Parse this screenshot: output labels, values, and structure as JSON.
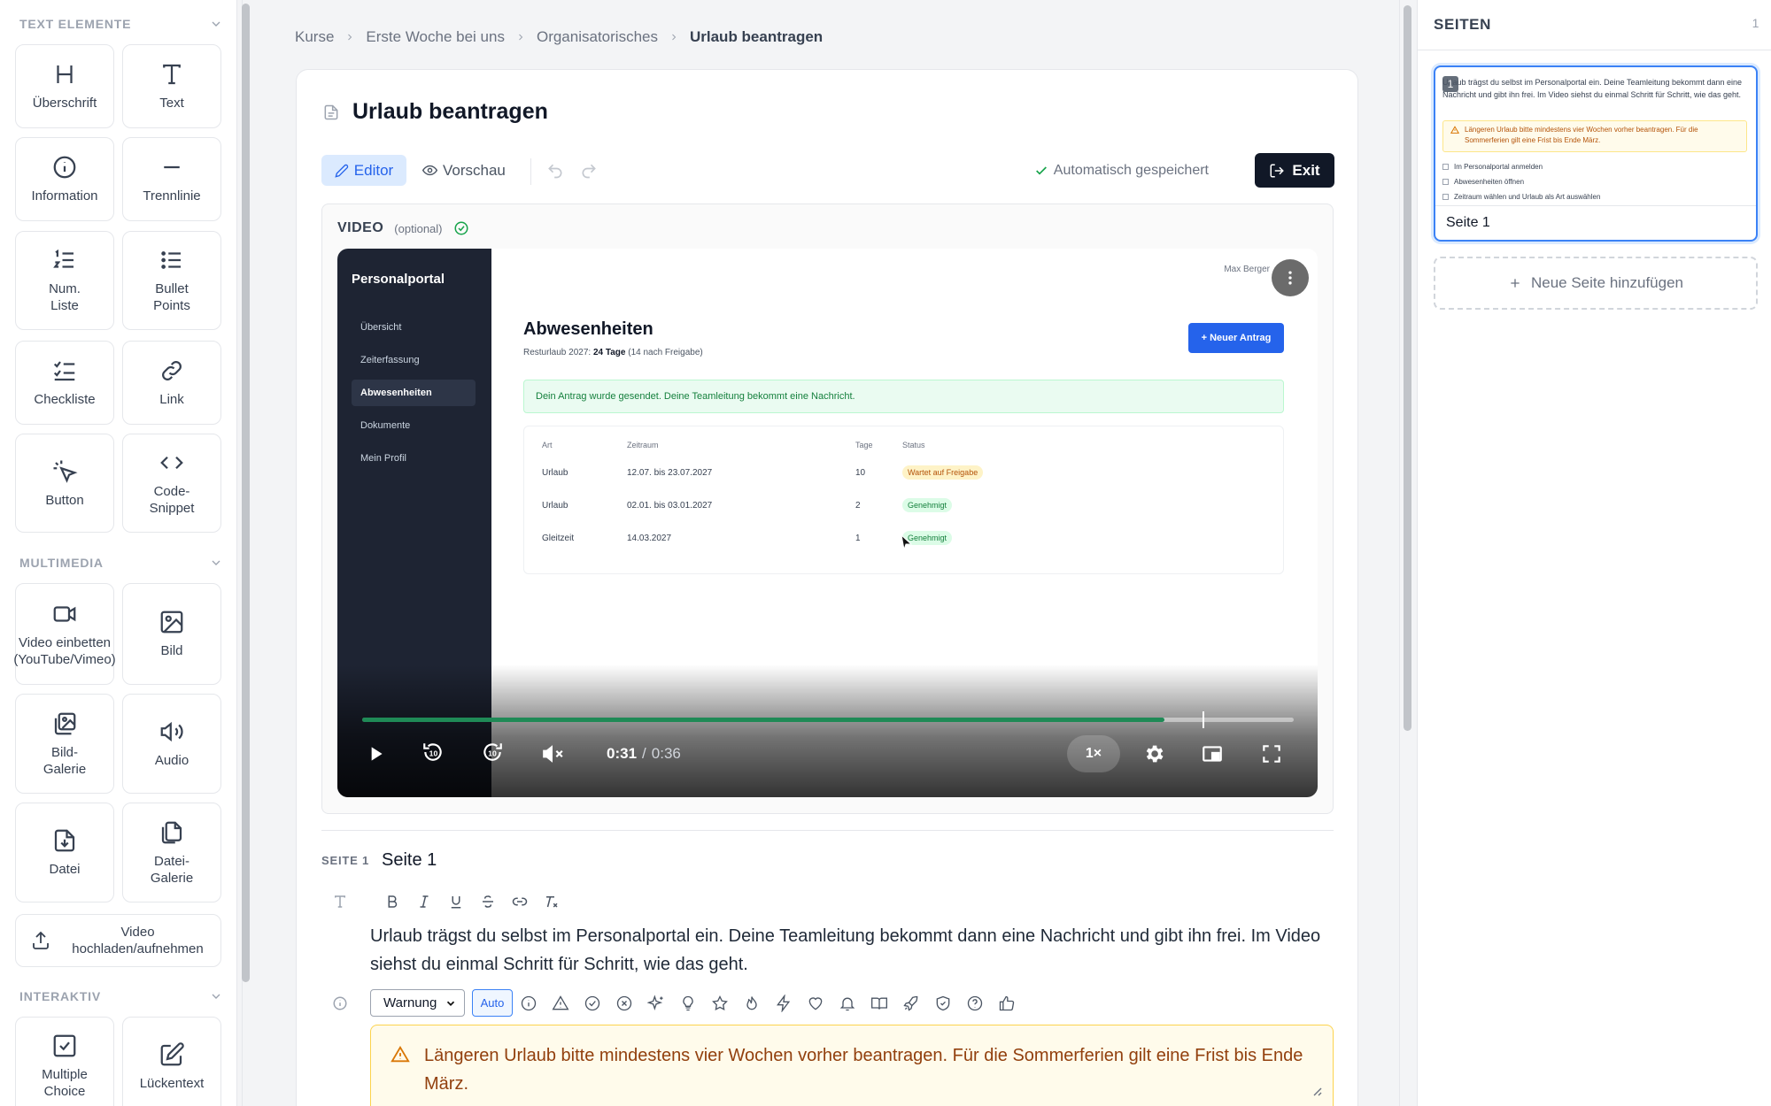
{
  "sidebar": {
    "text_section": "TEXT ELEMENTE",
    "text_items": [
      "Überschrift",
      "Text",
      "Information",
      "Trennlinie",
      "Num.\nListe",
      "Bullet\nPoints",
      "Checkliste",
      "Link",
      "Button",
      "Code-\nSnippet"
    ],
    "media_section": "MULTIMEDIA",
    "media_items": [
      "Video einbetten\n(YouTube/Vimeo)",
      "Bild",
      "Bild-\nGalerie",
      "Audio",
      "Datei",
      "Datei-\nGalerie"
    ],
    "upload_item": "Video\nhochladen/aufnehmen",
    "interactive_section": "INTERAKTIV",
    "interactive_items": [
      "Multiple\nChoice",
      "Lückentext"
    ]
  },
  "breadcrumb": [
    "Kurse",
    "Erste Woche bei uns",
    "Organisatorisches",
    "Urlaub beantragen"
  ],
  "page_title": "Urlaub beantragen",
  "toolbar": {
    "editor": "Editor",
    "preview": "Vorschau",
    "saved": "Automatisch gespeichert",
    "exit": "Exit"
  },
  "video": {
    "label": "VIDEO",
    "optional": "(optional)",
    "time_current": "0:31",
    "time_separator": "/",
    "time_total": "0:36",
    "progress": 0.861,
    "buffered": 0.902,
    "speed": "1×",
    "content": {
      "brand": "Personalportal",
      "nav": [
        "Übersicht",
        "Zeiterfassung",
        "Abwesenheiten",
        "Dokumente",
        "Mein Profil"
      ],
      "user": "Max Berger",
      "heading": "Abwesenheiten",
      "sub_prefix": "Resturlaub 2027:",
      "sub_bold": "24 Tage",
      "sub_suffix": "(14 nach Freigabe)",
      "new_button": "+ Neuer Antrag",
      "success": "Dein Antrag wurde gesendet. Deine Teamleitung bekommt eine Nachricht.",
      "table_headers": [
        "Art",
        "Zeitraum",
        "Tage",
        "Status"
      ],
      "rows": [
        {
          "art": "Urlaub",
          "zeitraum": "12.07. bis 23.07.2027",
          "tage": "10",
          "status": "Wartet auf Freigabe"
        },
        {
          "art": "Urlaub",
          "zeitraum": "02.01. bis 03.01.2027",
          "tage": "2",
          "status": "Genehmigt"
        },
        {
          "art": "Gleitzeit",
          "zeitraum": "14.03.2027",
          "tage": "1",
          "status": "Genehmigt"
        }
      ]
    }
  },
  "page_block": {
    "tag": "SEITE 1",
    "name": "Seite 1",
    "text": "Urlaub trägst du selbst im Personalportal ein. Deine Teamleitung bekommt dann eine Nachricht und gibt ihn frei. Im Video siehst du einmal Schritt für Schritt, wie das geht.",
    "callout_type": "Warnung",
    "auto": "Auto",
    "callout_text": "Längeren Urlaub bitte mindestens vier Wochen vorher beantragen. Für die Sommerferien gilt eine Frist bis Ende März."
  },
  "pages_panel": {
    "title": "SEITEN",
    "count": "1",
    "thumb_number": "1",
    "thumb_text": "Urlaub trägst du selbst im Personalportal ein. Deine Teamleitung bekommt dann eine Nachricht und gibt ihn frei. Im Video siehst du einmal Schritt für Schritt, wie das geht.",
    "thumb_warning": "Längeren Urlaub bitte mindestens vier Wochen vorher beantragen. Für die Sommerferien gilt eine Frist bis Ende März.",
    "thumb_checks": [
      "Im Personalportal anmelden",
      "Abwesenheiten öffnen",
      "Zeitraum wählen und Urlaub als Art auswählen"
    ],
    "page_name": "Seite 1",
    "add_page": "Neue Seite hinzufügen"
  },
  "colors": {
    "accent": "#2563eb",
    "progress": "#1f8a56",
    "warning_bg": "#fffbeb",
    "warning_text": "#92400e",
    "dark_button": "#111827"
  },
  "icons": {
    "text_items": [
      "heading-icon",
      "text-icon",
      "info-icon",
      "divider-icon",
      "numbered-list-icon",
      "bullet-list-icon",
      "checklist-icon",
      "link-icon",
      "cursor-click-icon",
      "code-icon"
    ],
    "media_items": [
      "video-camera-icon",
      "image-icon",
      "image-gallery-icon",
      "speaker-icon",
      "file-download-icon",
      "files-icon"
    ],
    "upload_item": "upload-icon",
    "interactive_items": [
      "checkbox-icon",
      "edit-icon"
    ]
  }
}
